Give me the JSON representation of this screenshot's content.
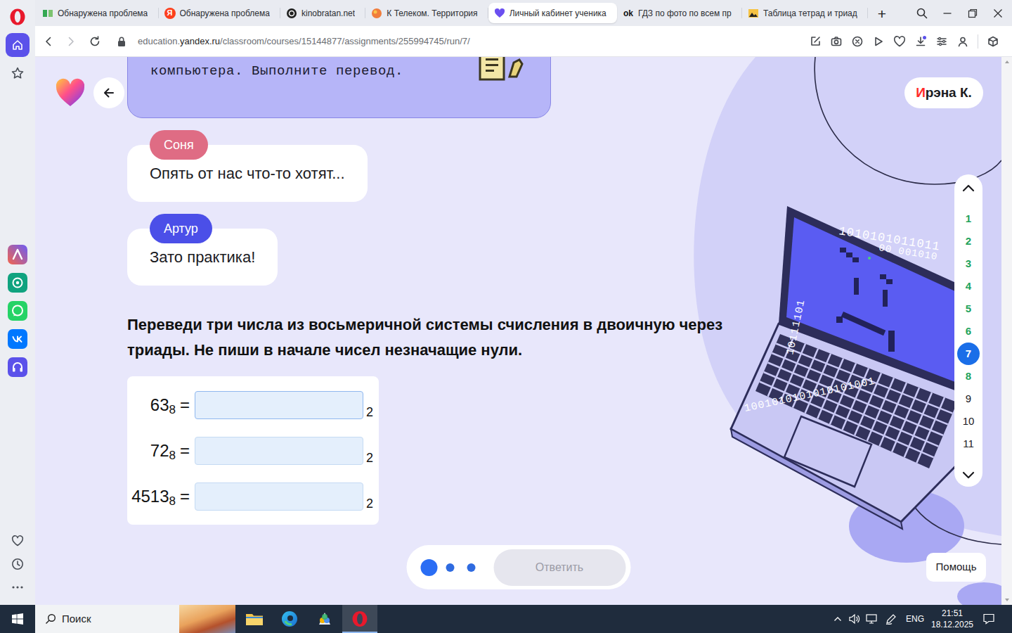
{
  "sidebar": {
    "items": [
      {
        "kind": "home",
        "selected": true
      },
      {
        "kind": "bookmarks",
        "selected": false
      }
    ],
    "apps": [
      {
        "kind": "aria"
      },
      {
        "kind": "chatgpt"
      },
      {
        "kind": "whatsapp"
      },
      {
        "kind": "vk"
      },
      {
        "kind": "player"
      }
    ],
    "bottom": [
      {
        "kind": "favorites"
      },
      {
        "kind": "history"
      },
      {
        "kind": "more"
      }
    ]
  },
  "browser": {
    "tabs": [
      {
        "label": "Обнаружена проблема",
        "selected": false,
        "kind": "sheets"
      },
      {
        "label": "Обнаружена проблема",
        "selected": false,
        "kind": "yandex",
        "icon_text": "Я"
      },
      {
        "label": "kinobratan.net",
        "selected": false,
        "kind": "kino"
      },
      {
        "label": "К Телеком. Территория",
        "selected": false,
        "kind": "ktelecom"
      },
      {
        "label": "Личный кабинет ученика",
        "selected": true,
        "kind": "uchebnik"
      },
      {
        "label": "ГДЗ по фото по всем пр",
        "selected": false,
        "kind": "ok",
        "icon_text": "ok"
      },
      {
        "label": "Таблица тетрад и триад",
        "selected": false,
        "kind": "photo"
      }
    ],
    "new_tab": "+",
    "back_disabled": false,
    "forward_disabled": true,
    "url": {
      "subdomain": "education.",
      "host": "yandex.ru",
      "path": "/classroom/courses/15144877/assignments/255994745/run/7/"
    }
  },
  "page": {
    "user": {
      "initial": "И",
      "rest": "рэна К."
    },
    "intro": "компьютера. Выполните перевод.",
    "messages": [
      {
        "speaker": "Соня",
        "text": "Опять от нас что-то хотят...",
        "color": "#df6c84"
      },
      {
        "speaker": "Артур",
        "text": "Зато практика!",
        "color": "#4b4fe8"
      }
    ],
    "task": "Переведи три числа из восьмеричной системы счисления в двоичную через триады. Не пиши в начале чисел незначащие нули.",
    "rows": [
      {
        "number": "63",
        "base": "8",
        "equals": "=",
        "value": "",
        "target_base": "2",
        "focused": true
      },
      {
        "number": "72",
        "base": "8",
        "equals": "=",
        "value": "",
        "target_base": "2",
        "focused": false
      },
      {
        "number": "4513",
        "base": "8",
        "equals": "=",
        "value": "",
        "target_base": "2",
        "focused": false
      }
    ],
    "steps": [
      {
        "label": "1",
        "done": true,
        "selected": false
      },
      {
        "label": "2",
        "done": true,
        "selected": false
      },
      {
        "label": "3",
        "done": true,
        "selected": false
      },
      {
        "label": "4",
        "done": true,
        "selected": false
      },
      {
        "label": "5",
        "done": true,
        "selected": false
      },
      {
        "label": "6",
        "done": true,
        "selected": false
      },
      {
        "label": "7",
        "done": false,
        "selected": true
      },
      {
        "label": "8",
        "done": true,
        "selected": false
      },
      {
        "label": "9",
        "done": false,
        "selected": false
      },
      {
        "label": "10",
        "done": false,
        "selected": false
      },
      {
        "label": "11",
        "done": false,
        "selected": false
      }
    ],
    "pager": [
      {
        "selected": true
      },
      {
        "selected": false
      },
      {
        "selected": false
      }
    ],
    "submit": {
      "label": "Ответить",
      "disabled": true
    },
    "help": "Помощь",
    "binary": [
      "1010101011011",
      "00 001010",
      "10111101",
      "1001010101010101001"
    ]
  },
  "taskbar": {
    "search": "Поиск",
    "apps": [
      {
        "kind": "explorer",
        "active": false
      },
      {
        "kind": "edge",
        "active": false
      },
      {
        "kind": "paint",
        "active": false
      },
      {
        "kind": "opera",
        "active": true
      }
    ],
    "lang": "ENG",
    "time": "21:51",
    "date": "18.12.2025"
  }
}
